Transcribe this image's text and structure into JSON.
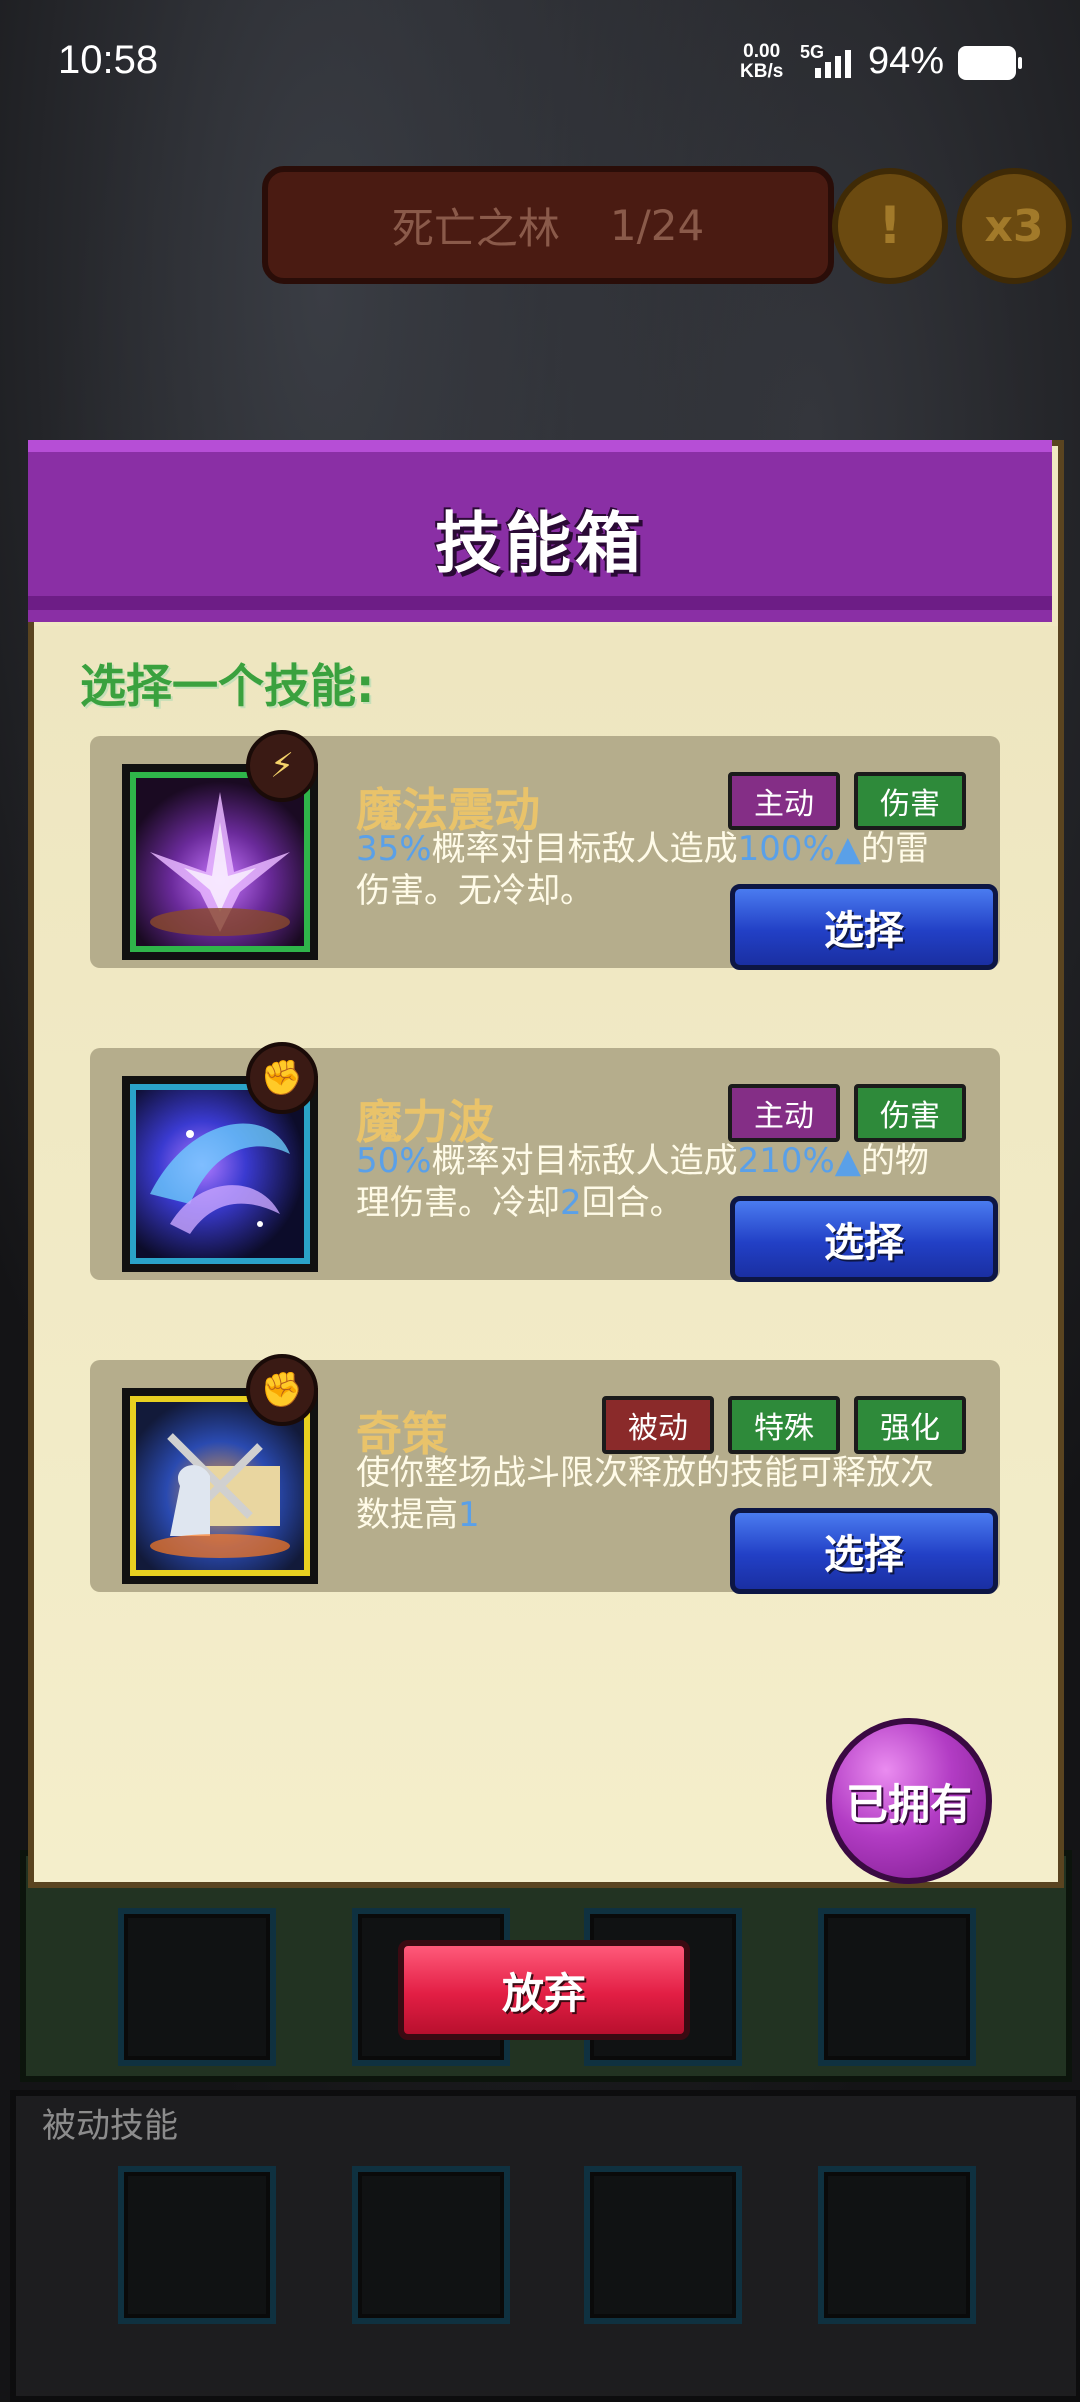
{
  "status_bar": {
    "time": "10:58",
    "net_speed_value": "0.00",
    "net_speed_unit": "KB/s",
    "network_type": "5G",
    "battery_percent": "94%"
  },
  "stage": {
    "name": "死亡之林",
    "progress": "1/24",
    "hint_icon": "!",
    "speed_label": "x3"
  },
  "skill_box": {
    "title": "技能箱",
    "prompt": "选择一个技能:",
    "skills": [
      {
        "name": "魔法震动",
        "tags": [
          "主动",
          "伤害"
        ],
        "desc_parts": [
          "35%",
          "概率对目标敌人造成",
          "100%",
          "的雷伤害。无冷却。"
        ],
        "select_label": "选择",
        "icon": "purple-crystal-burst-icon",
        "badge_icon": "lightning-badge-icon"
      },
      {
        "name": "魔力波",
        "tags": [
          "主动",
          "伤害"
        ],
        "desc_parts": [
          "50%",
          "概率对目标敌人造成",
          "210%",
          "的物理伤害。冷却",
          "2",
          "回合。"
        ],
        "select_label": "选择",
        "icon": "magic-wave-icon",
        "badge_icon": "fist-badge-icon"
      },
      {
        "name": "奇策",
        "tags": [
          "被动",
          "特殊",
          "强化"
        ],
        "desc_parts": [
          "使你整场战斗限次释放的技能可释放次数提高",
          "1"
        ],
        "select_label": "选择",
        "icon": "strategy-scroll-icon",
        "badge_icon": "fist-badge-icon"
      }
    ],
    "owned_label": "已拥有",
    "give_up_label": "放弃"
  },
  "back_panels": {
    "passive_skills_label": "被动技能"
  },
  "colors": {
    "header_purple": "#8a2fa5",
    "select_blue": "#2240c6",
    "give_up_red": "#e21e44",
    "tag_purple": "#842e86",
    "tag_green": "#2e8a3a",
    "tag_red": "#8a2a2a",
    "number_blue": "#5aa0e8"
  }
}
